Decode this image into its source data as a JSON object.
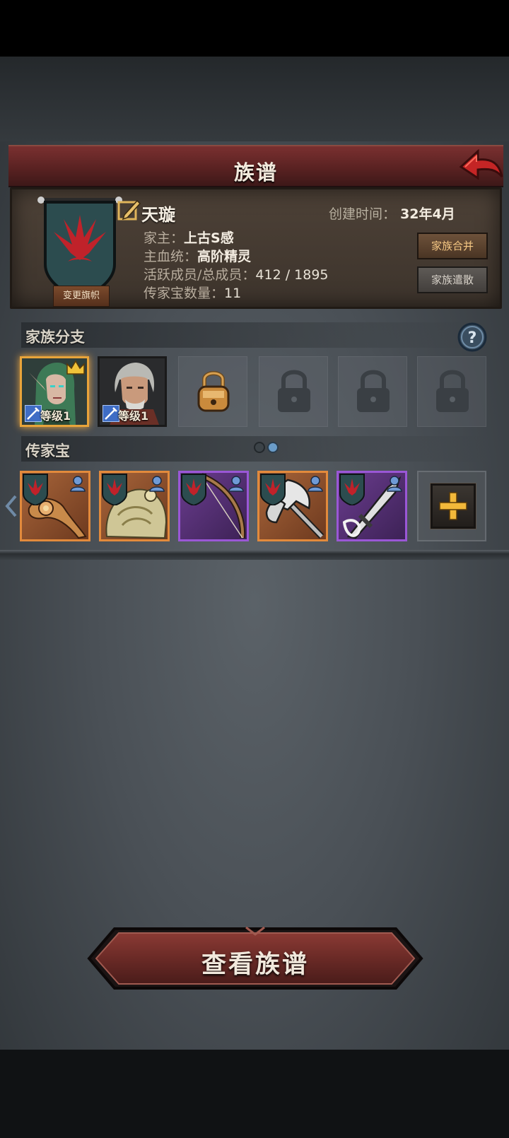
{
  "title": "族谱",
  "clan": {
    "name": "天璇",
    "created_label": "创建时间：",
    "created_value": "32年4月",
    "change_banner_label": "变更旗帜",
    "head_label": "家主：",
    "head_value": "上古S感",
    "bloodline_label": "主血统：",
    "bloodline_value": "高阶精灵",
    "members_label": "活跃成员/总成员：",
    "members_value": "412 / 1895",
    "heirloom_count_label": "传家宝数量：",
    "heirloom_count_value": "11",
    "merge_label": "家族合并",
    "disband_label": "家族遣散"
  },
  "branches": {
    "title": "家族分支",
    "members": [
      {
        "level": "等级1",
        "leader": true
      },
      {
        "level": "等级1",
        "leader": false
      }
    ],
    "locked_slots": 4
  },
  "heirlooms": {
    "title": "传家宝",
    "items": [
      {
        "rarity": "orange",
        "type": "ornate-staff"
      },
      {
        "rarity": "orange",
        "type": "golden-armor"
      },
      {
        "rarity": "purple",
        "type": "bow"
      },
      {
        "rarity": "orange",
        "type": "battle-axe"
      },
      {
        "rarity": "purple",
        "type": "great-sword"
      }
    ],
    "add_label": "+"
  },
  "view_button_label": "查看族谱",
  "colors": {
    "title_bar": "#6b2828",
    "leader_border": "#e8a43a",
    "orange_rarity": "#e28a3c",
    "purple_rarity": "#9a57d6",
    "banner_emblem": "#c0222a"
  }
}
